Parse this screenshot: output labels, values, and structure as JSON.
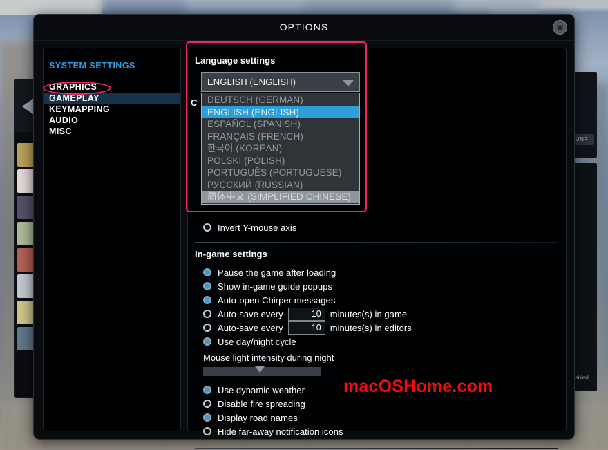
{
  "window": {
    "title": "OPTIONS",
    "close_icon": "close-icon"
  },
  "sidebar": {
    "heading": "SYSTEM SETTINGS",
    "items": [
      {
        "label": "GRAPHICS",
        "selected": false
      },
      {
        "label": "GAMEPLAY",
        "selected": true
      },
      {
        "label": "KEYMAPPING",
        "selected": false
      },
      {
        "label": "AUDIO",
        "selected": false
      },
      {
        "label": "MISC",
        "selected": false
      }
    ]
  },
  "language_section": {
    "title": "Language settings",
    "dropdown": {
      "selected": "ENGLISH (ENGLISH)",
      "caret_icon": "chevron-down-icon",
      "expanded": true,
      "options": [
        {
          "label": "DEUTSCH (GERMAN)",
          "state": "normal"
        },
        {
          "label": "ENGLISH (ENGLISH)",
          "state": "selected"
        },
        {
          "label": "ESPAÑOL (SPANISH)",
          "state": "normal"
        },
        {
          "label": "FRANÇAIS (FRENCH)",
          "state": "normal"
        },
        {
          "label": "한국어 (KOREAN)",
          "state": "normal"
        },
        {
          "label": "POLSKI (POLISH)",
          "state": "normal"
        },
        {
          "label": "PORTUGUÊS (PORTUGUESE)",
          "state": "normal"
        },
        {
          "label": "РУССКИЙ (RUSSIAN)",
          "state": "normal"
        },
        {
          "label": "简体中文 (SIMPLIFIED CHINESE)",
          "state": "hovered"
        }
      ]
    },
    "obscured_label": "C",
    "invert_axis": {
      "label": "Invert Y-mouse axis",
      "checked": false
    }
  },
  "ingame_section": {
    "title": "In-game settings",
    "options": [
      {
        "label": "Pause the game after loading",
        "checked": true,
        "type": "radio"
      },
      {
        "label": "Show in-game guide popups",
        "checked": true,
        "type": "radio"
      },
      {
        "label": "Auto-open Chirper messages",
        "checked": true,
        "type": "radio"
      }
    ],
    "autosave_game": {
      "label": "Auto-save every",
      "value": "10",
      "suffix": "minutes(s) in game",
      "checked": false
    },
    "autosave_editors": {
      "label": "Auto-save every",
      "value": "10",
      "suffix": "minutes(s) in editors",
      "checked": false
    },
    "daynight": {
      "label": "Use day/night cycle",
      "checked": true
    },
    "slider": {
      "label": "Mouse light intensity during night",
      "value_percent": 48
    },
    "options_bottom": [
      {
        "label": "Use dynamic weather",
        "checked": true
      },
      {
        "label": "Disable fire spreading",
        "checked": false
      },
      {
        "label": "Display road names",
        "checked": true
      },
      {
        "label": "Hide far-away notification icons",
        "checked": false
      }
    ]
  },
  "annotations": {
    "watermark": "macOSHome.com",
    "accent_color": "#f4245e",
    "watermark_color": "#f40b0b"
  }
}
